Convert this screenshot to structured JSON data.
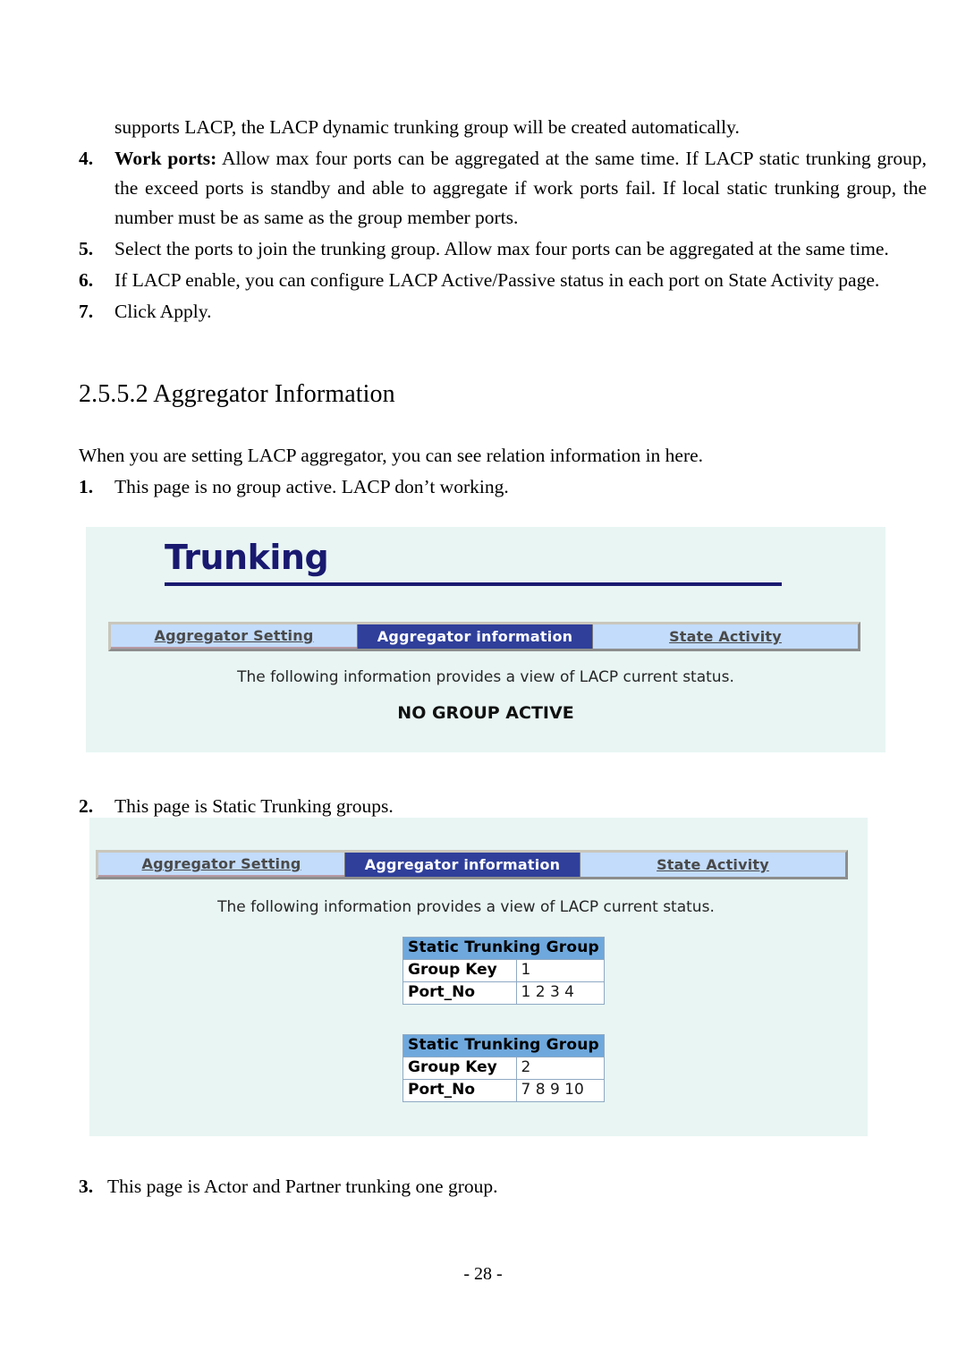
{
  "document": {
    "continued_paragraph": "supports LACP, the LACP dynamic trunking group will be created automatically.",
    "list_items": [
      {
        "number": "4.",
        "lead": "Work ports:",
        "text": " Allow max four ports can be aggregated at the same time. If LACP static trunking group, the exceed ports is standby and able to aggregate if work ports fail. If local static trunking group, the number must be as same as the group member ports."
      },
      {
        "number": "5.",
        "lead": "",
        "text": "Select the ports to join the trunking group. Allow max four ports can be aggregated at the same time."
      },
      {
        "number": "6.",
        "lead": "",
        "text": "If LACP enable, you can configure LACP Active/Passive status in each port on State Activity page."
      },
      {
        "number": "7.",
        "lead": "",
        "text": "Click Apply."
      }
    ],
    "section_heading": "2.5.5.2 Aggregator Information",
    "intro": "When you are setting LACP aggregator, you can see relation information in here.",
    "figure_captions": [
      {
        "number": "1.",
        "text": "This page is no group active. LACP don’t working."
      },
      {
        "number": "2.",
        "text": "This page is Static Trunking groups."
      },
      {
        "number": "3.",
        "text": "This page is Actor and Partner trunking one group."
      }
    ],
    "page_footer": "- 28 -"
  },
  "screenshot_1": {
    "title": "Trunking",
    "tabs": [
      {
        "label": "Aggregator Setting",
        "active": false
      },
      {
        "label": "Aggregator information",
        "active": true
      },
      {
        "label": "State Activity",
        "active": false
      }
    ],
    "description": "The following information provides a view of LACP current status.",
    "status": "NO GROUP ACTIVE"
  },
  "screenshot_2": {
    "tabs": [
      {
        "label": "Aggregator Setting",
        "active": false
      },
      {
        "label": "Aggregator information",
        "active": true
      },
      {
        "label": "State Activity",
        "active": false
      }
    ],
    "description": "The following information provides a view of LACP current status.",
    "tables": [
      {
        "header": "Static Trunking Group",
        "rows": [
          {
            "key": "Group Key",
            "value": "1"
          },
          {
            "key": "Port_No",
            "value": "1 2 3 4"
          }
        ]
      },
      {
        "header": "Static Trunking Group",
        "rows": [
          {
            "key": "Group Key",
            "value": "2"
          },
          {
            "key": "Port_No",
            "value": "7 8 9 10"
          }
        ]
      }
    ]
  },
  "colors": {
    "panel_background": "#e8f5f3",
    "title_navy": "#191970",
    "tab_active_bg": "#2f3f9a",
    "tab_inactive_bg": "#c3dcfb",
    "table_header_bg": "#6fa8dc"
  }
}
